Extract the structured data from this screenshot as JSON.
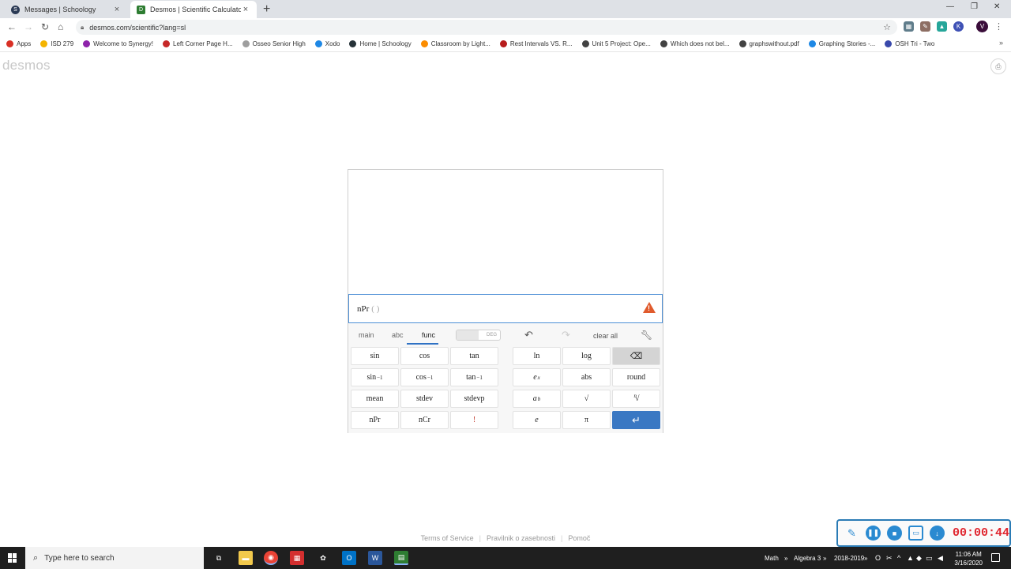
{
  "browser": {
    "tabs": [
      {
        "title": "Messages | Schoology",
        "favicon": "S",
        "active": false
      },
      {
        "title": "Desmos | Scientific Calculator",
        "favicon": "D",
        "active": true
      }
    ],
    "url": "desmos.com/scientific?lang=sl",
    "bookmarks": [
      {
        "label": "Apps",
        "color": "#d93025"
      },
      {
        "label": "ISD 279",
        "color": "#f4b400"
      },
      {
        "label": "Welcome to Synergy!",
        "color": "#8e24aa"
      },
      {
        "label": "Left Corner Page H...",
        "color": "#c62828"
      },
      {
        "label": "Osseo Senior High",
        "color": "#9e9e9e"
      },
      {
        "label": "Xodo",
        "color": "#1e88e5"
      },
      {
        "label": "Home | Schoology",
        "color": "#263238"
      },
      {
        "label": "Classroom by Light...",
        "color": "#fb8c00"
      },
      {
        "label": "Rest Intervals VS. R...",
        "color": "#b71c1c"
      },
      {
        "label": "Unit 5 Project: Ope...",
        "color": "#424242"
      },
      {
        "label": "Which does not bel...",
        "color": "#424242"
      },
      {
        "label": "graphswithout.pdf",
        "color": "#424242"
      },
      {
        "label": "Graphing Stories -...",
        "color": "#1e88e5"
      },
      {
        "label": "OSH Tri - Two",
        "color": "#3949ab"
      }
    ]
  },
  "page": {
    "logo": "desmos",
    "footer": {
      "terms": "Terms of Service",
      "privacy": "Pravilnik o zasebnosti",
      "help": "Pomoč"
    }
  },
  "calculator": {
    "expression": "nPr",
    "expression_paren": "( )",
    "tabs": {
      "main": "main",
      "abc": "abc",
      "func": "func"
    },
    "deg_label": "DEG",
    "clear_all": "clear all",
    "keys": {
      "sin": "sin",
      "cos": "cos",
      "tan": "tan",
      "asin": "sin",
      "acos": "cos",
      "atan": "tan",
      "inv_sup": "−1",
      "mean": "mean",
      "stdev": "stdev",
      "stdevp": "stdevp",
      "npr": "nPr",
      "ncr": "nCr",
      "fact": "!",
      "ln": "ln",
      "log": "log",
      "ex_base": "e",
      "ex_sup": "x",
      "abs": "abs",
      "round": "round",
      "ab_base": "a",
      "ab_sup": "b",
      "sqrt": "√",
      "nroot_sup": "n",
      "nroot": "√",
      "e": "e",
      "pi": "π"
    }
  },
  "recorder": {
    "timer": "00:00:44"
  },
  "taskbar": {
    "search_placeholder": "Type here to search",
    "tray_math": "Math",
    "tray_algebra": "Algebra 3",
    "tray_year": "2018-2019",
    "time": "11:06 AM",
    "date": "3/16/2020"
  }
}
